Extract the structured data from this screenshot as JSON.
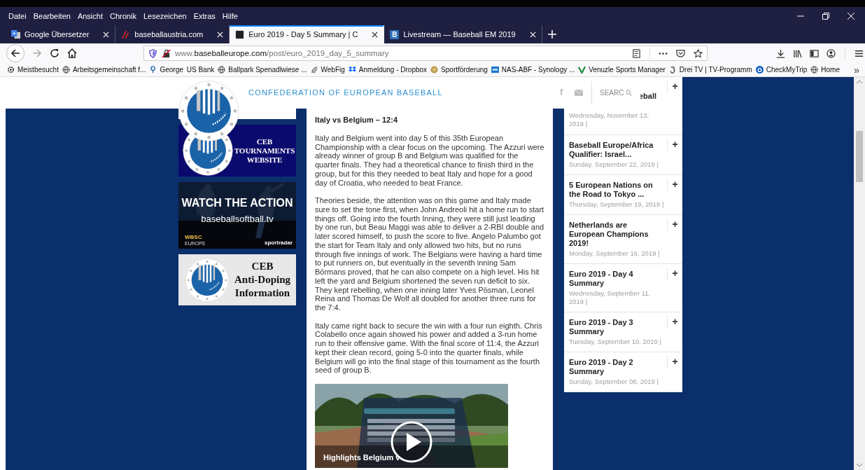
{
  "menu_bar": [
    "Datei",
    "Bearbeiten",
    "Ansicht",
    "Chronik",
    "Lesezeichen",
    "Extras",
    "Hilfe"
  ],
  "tabs": [
    {
      "title": "Google Übersetzer",
      "kind": "translate",
      "selected": false
    },
    {
      "title": "baseballaustria.com",
      "kind": "stripes",
      "selected": false
    },
    {
      "title": "Euro 2019 - Day 5 Summary | C",
      "kind": "square",
      "selected": true
    },
    {
      "title": "Livestream — Baseball EM 2019",
      "kind": "letter",
      "favicon_text": "B",
      "selected": false
    }
  ],
  "address": {
    "prefix": "www.",
    "domain": "baseballeurope.com",
    "path": "/post/euro_2019_day_5_summary"
  },
  "bookmarks": [
    {
      "label": "Meistbesucht",
      "kind": "gear"
    },
    {
      "label": "Arbeitsgemeinschaft f...",
      "kind": "globe"
    },
    {
      "label": "George",
      "kind": "pin"
    },
    {
      "label": "US Bank",
      "kind": "plain"
    },
    {
      "label": "Ballpark Spenadlwiese ...",
      "kind": "globe"
    },
    {
      "label": "WebFig",
      "kind": "arcs"
    },
    {
      "label": "Anmeldung - Dropbox",
      "kind": "box"
    },
    {
      "label": "Sportförderung",
      "kind": "coin"
    },
    {
      "label": "NAS-ABF - Synology ...",
      "kind": "tile"
    },
    {
      "label": "Venuzle Sports Manager",
      "kind": "vmark"
    },
    {
      "label": "Drei TV | TV-Programm",
      "kind": "spiral"
    },
    {
      "label": "CheckMyTrip",
      "kind": "disc"
    },
    {
      "label": "Home",
      "kind": "globe"
    }
  ],
  "bookmarks_overflow": "»",
  "site_header": {
    "title": "CONFEDERATION OF EUROPEAN BASEBALL",
    "social": "f",
    "search_placeholder": "SEARC"
  },
  "banners": [
    {
      "kind": "logo",
      "lines": [
        "CEB",
        "TOURNAMENTS",
        "WEBSITE"
      ]
    },
    {
      "kind": "video",
      "headline": "WATCH THE ACTION",
      "url": "baseballsoftball.tv",
      "left_logo": "WBSC",
      "left_sub": "EUROPE",
      "right_logo": "sportradar"
    },
    {
      "kind": "light",
      "lines": [
        "CEB",
        "Anti-Doping",
        "Information"
      ]
    }
  ],
  "article": {
    "heading": "Italy vs Belgium – 12:4",
    "paragraphs": [
      "Italy and Belgium went into day 5 of this 35th European Championship with a clear focus on the upcoming. The Azzuri were already winner of group B and Belgium was qualified for the quarter finals. They had a theoretical chance to finish third in the group, but for this they needed to beat Italy and hope for a good day of Croatia, who needed to beat France.",
      "Theories beside, the attention was on this game and Italy made sure to set the tone first, when John Andreoli hit a home run to start things off. Going into the fourth Inning, they were still just leading by one run, but Beau Maggi was able to deliver a 2-RBI double and later scored himself, to push the score to five. Angelo Palumbo got the start for Team Italy and only allowed two hits, but no runs through five innings of work. The Belgians were having a hard time to put runners on, but eventually in the seventh inning Sam Börmans proved, that he can also compete on a high level. His hit left the yard and Belgium shortened the seven run deficit to six. They kept rebelling, when one inning later Yves Pösman, Leonel Reina and Thomas De Wolf all doubled for another three runs for the 7:4.",
      "Italy came right back to secure the win with a four run eighth. Chris Colabello once again showed his power and added a 3-run home run to their offensive game. With the final score of 11:4, the Azzuri kept their clean record, going 5-0 into the quarter finals, while Belgium will go into the final stage of this tournament as the fourth seed of group B."
    ],
    "video": {
      "title": "Highlights Belgium v"
    }
  },
  "sidebar_posts": [
    {
      "title": "eball",
      "date": "Wednesday, November 13, 2019 |"
    },
    {
      "title": "Baseball Europe/Africa Qualifier: Israel...",
      "date": "Sunday, September 22, 2019 |"
    },
    {
      "title": "5 European Nations on the Road to Tokyo ...",
      "date": "Thursday, September 19, 2019 |"
    },
    {
      "title": "Netherlands are European Champions 2019!",
      "date": "Monday, September 16, 2019 |"
    },
    {
      "title": "Euro 2019 - Day 4 Summary",
      "date": "Wednesday, September 11, 2019 |"
    },
    {
      "title": "Euro 2019 - Day 3 Summary",
      "date": "Tuesday, September 10, 2019 |"
    },
    {
      "title": "Euro 2019 - Day 2 Summary",
      "date": "Sunday, September 08, 2019 |"
    }
  ],
  "sidebar_expand": "+"
}
